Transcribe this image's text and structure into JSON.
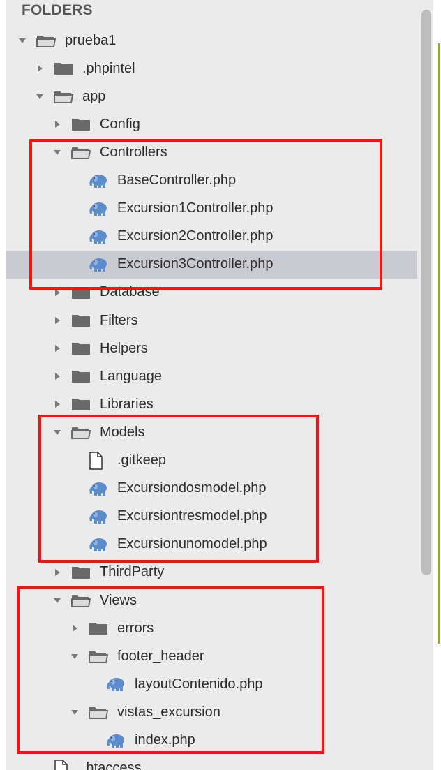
{
  "sidebar": {
    "header": "FOLDERS",
    "rows": [
      {
        "label": "prueba1",
        "icon": "folder-open-icon",
        "expanded": true,
        "depth": 0,
        "type": "folder"
      },
      {
        "label": ".phpintel",
        "icon": "folder-closed-icon",
        "expanded": false,
        "depth": 1,
        "type": "folder"
      },
      {
        "label": "app",
        "icon": "folder-open-icon",
        "expanded": true,
        "depth": 1,
        "type": "folder"
      },
      {
        "label": "Config",
        "icon": "folder-closed-icon",
        "expanded": false,
        "depth": 2,
        "type": "folder"
      },
      {
        "label": "Controllers",
        "icon": "folder-open-icon",
        "expanded": true,
        "depth": 2,
        "type": "folder"
      },
      {
        "label": "BaseController.php",
        "icon": "php-elephant-icon",
        "depth": 3,
        "type": "file"
      },
      {
        "label": "Excursion1Controller.php",
        "icon": "php-elephant-icon",
        "depth": 3,
        "type": "file"
      },
      {
        "label": "Excursion2Controller.php",
        "icon": "php-elephant-icon",
        "depth": 3,
        "type": "file"
      },
      {
        "label": "Excursion3Controller.php",
        "icon": "php-elephant-icon",
        "depth": 3,
        "type": "file",
        "selected": true
      },
      {
        "label": "Database",
        "icon": "folder-closed-icon",
        "expanded": false,
        "depth": 2,
        "type": "folder"
      },
      {
        "label": "Filters",
        "icon": "folder-closed-icon",
        "expanded": false,
        "depth": 2,
        "type": "folder"
      },
      {
        "label": "Helpers",
        "icon": "folder-closed-icon",
        "expanded": false,
        "depth": 2,
        "type": "folder"
      },
      {
        "label": "Language",
        "icon": "folder-closed-icon",
        "expanded": false,
        "depth": 2,
        "type": "folder"
      },
      {
        "label": "Libraries",
        "icon": "folder-closed-icon",
        "expanded": false,
        "depth": 2,
        "type": "folder"
      },
      {
        "label": "Models",
        "icon": "folder-open-icon",
        "expanded": true,
        "depth": 2,
        "type": "folder"
      },
      {
        "label": ".gitkeep",
        "icon": "blank-file-icon",
        "depth": 3,
        "type": "file"
      },
      {
        "label": "Excursiondosmodel.php",
        "icon": "php-elephant-icon",
        "depth": 3,
        "type": "file"
      },
      {
        "label": "Excursiontresmodel.php",
        "icon": "php-elephant-icon",
        "depth": 3,
        "type": "file"
      },
      {
        "label": "Excursionunomodel.php",
        "icon": "php-elephant-icon",
        "depth": 3,
        "type": "file"
      },
      {
        "label": "ThirdParty",
        "icon": "folder-closed-icon",
        "expanded": false,
        "depth": 2,
        "type": "folder"
      },
      {
        "label": "Views",
        "icon": "folder-open-icon",
        "expanded": true,
        "depth": 2,
        "type": "folder"
      },
      {
        "label": "errors",
        "icon": "folder-closed-icon",
        "expanded": false,
        "depth": 3,
        "type": "folder"
      },
      {
        "label": "footer_header",
        "icon": "folder-open-icon",
        "expanded": true,
        "depth": 3,
        "type": "folder"
      },
      {
        "label": "layoutContenido.php",
        "icon": "php-elephant-icon",
        "depth": 4,
        "type": "file"
      },
      {
        "label": "vistas_excursion",
        "icon": "folder-open-icon",
        "expanded": true,
        "depth": 3,
        "type": "folder"
      },
      {
        "label": "index.php",
        "icon": "php-elephant-icon",
        "depth": 4,
        "type": "file"
      },
      {
        "label": ".htaccess",
        "icon": "blank-file-icon",
        "depth": 1,
        "type": "file"
      }
    ]
  },
  "colors": {
    "sidebar_bg": "#ebebec",
    "selected_bg": "#cacbd1",
    "highlight": "#ff1010",
    "php_icon": "#5b8ccc",
    "folder_icon": "#6a6a6a"
  }
}
